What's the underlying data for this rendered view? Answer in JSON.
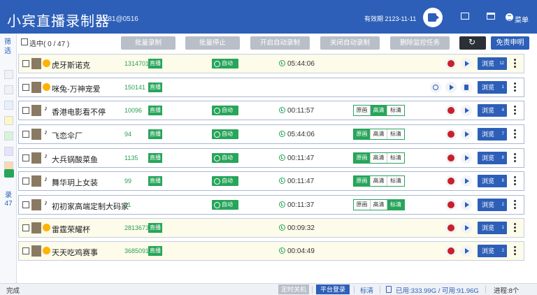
{
  "header": {
    "title": "小宾直播录制器",
    "version": "v1.81@0516",
    "expire": "有效期 2123-11-11",
    "menu_label": "菜单"
  },
  "sidebar": {
    "filter_label": "筛选",
    "count_label": "录47"
  },
  "toolbar": {
    "select_label": "选中( 0  /  47 )",
    "batch_record": "批量录制",
    "batch_stop": "批量停止",
    "auto_on": "开启自动录制",
    "auto_off": "关闭自动录制",
    "delete_task": "删除监控任务",
    "free_label": "免责申明"
  },
  "labels": {
    "live": "直播",
    "auto": "自动",
    "browse": "浏览",
    "q_orig": "原画",
    "q_high": "高清",
    "q_std": "标清"
  },
  "rows": [
    {
      "name": "虎牙斯诺克",
      "room": "1314701",
      "time": "05:44:06",
      "platform": "huya",
      "quality": null,
      "count": "12",
      "highlight": true,
      "live": true,
      "auto": true
    },
    {
      "name": "咪兔-万神宠爱",
      "room": "150141",
      "time": "",
      "platform": "huya",
      "quality": null,
      "count": "1",
      "highlight": false,
      "live": true,
      "auto": false
    },
    {
      "name": "香港电影看不停",
      "room": "10096",
      "time": "00:11:57",
      "platform": "douyin",
      "quality": "high",
      "count": "4",
      "highlight": false,
      "live": true,
      "auto": true
    },
    {
      "name": "飞恋伞厂",
      "room": "94",
      "time": "05:44:06",
      "platform": "douyin",
      "quality": "orig",
      "count": "7",
      "highlight": false,
      "live": true,
      "auto": true
    },
    {
      "name": "大兵锅酸菜鱼",
      "room": "1135",
      "time": "00:11:47",
      "platform": "douyin",
      "quality": "orig",
      "count": "8",
      "highlight": false,
      "live": true,
      "auto": true
    },
    {
      "name": "舞华玥上女装",
      "room": "99",
      "time": "00:11:47",
      "platform": "douyin",
      "quality": "orig",
      "count": "8",
      "highlight": false,
      "live": true,
      "auto": true
    },
    {
      "name": "初初家高端定制大码家",
      "room": "11",
      "time": "00:11:37",
      "platform": "douyin",
      "quality": "std",
      "count": "2",
      "highlight": false,
      "live": false,
      "auto": true
    },
    {
      "name": "雷霆荣耀杯",
      "room": "2813673",
      "time": "00:09:32",
      "platform": "huya",
      "quality": null,
      "count": "1",
      "highlight": true,
      "live": true,
      "auto": false
    },
    {
      "name": "天天吃鸡赛事",
      "room": "3685091",
      "time": "00:04:49",
      "platform": "huya",
      "quality": null,
      "count": "2",
      "highlight": true,
      "live": true,
      "auto": false
    }
  ],
  "status": {
    "done": "完成",
    "timer": "定时关机",
    "login": "平台登录",
    "quality": "标清",
    "disk": "已用:333.99G / 可用:91.96G",
    "procs": "进程:8个"
  }
}
